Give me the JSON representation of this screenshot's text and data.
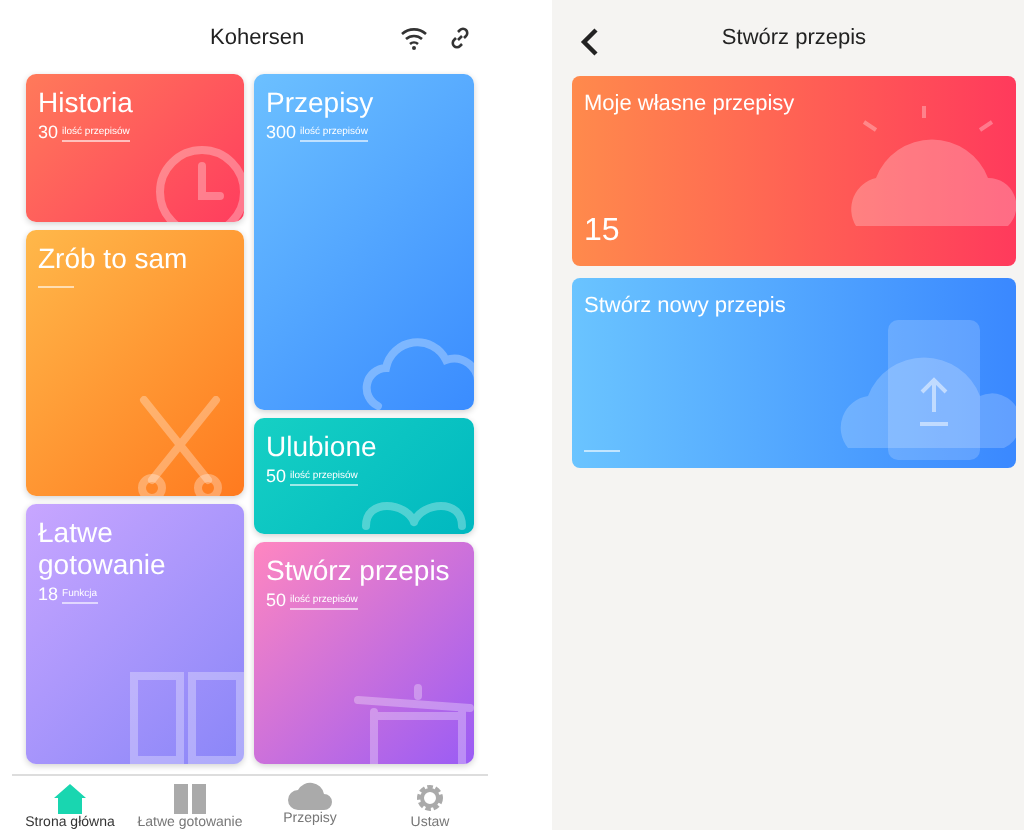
{
  "home": {
    "title": "Kohersen",
    "tiles": [
      {
        "title": "Historia",
        "count": "30",
        "unit": "ilość przepisów"
      },
      {
        "title": "Przepisy",
        "count": "300",
        "unit": "ilość przepisów"
      },
      {
        "title": "Zrób to sam"
      },
      {
        "title": "Ulubione",
        "count": "50",
        "unit": "ilość przepisów"
      },
      {
        "title": "Łatwe gotowanie",
        "count": "18",
        "unit": "Funkcja"
      },
      {
        "title": "Stwórz przepis",
        "count": "50",
        "unit": "ilość przepisów"
      }
    ],
    "nav": [
      {
        "label": "Strona główna",
        "selected": true
      },
      {
        "label": "Łatwe gotowanie",
        "selected": false
      },
      {
        "label": "Przepisy",
        "selected": false
      },
      {
        "label": "Ustaw",
        "selected": false
      }
    ]
  },
  "create": {
    "title": "Stwórz przepis",
    "cards": [
      {
        "title": "Moje własne przepisy",
        "count": "15"
      },
      {
        "title": "Stwórz nowy przepis"
      }
    ]
  }
}
